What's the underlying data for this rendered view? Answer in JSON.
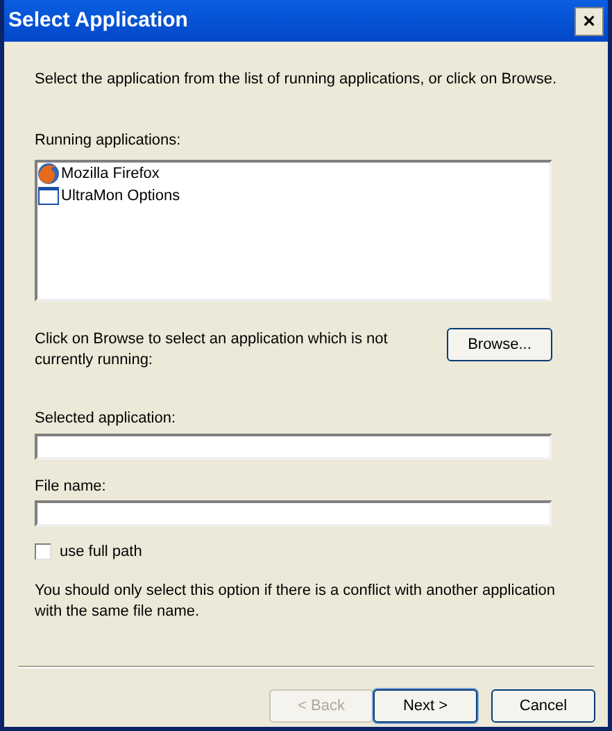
{
  "window": {
    "title": "Select Application",
    "close": "×"
  },
  "intro": "Select the application from the list of running applications, or click on Browse.",
  "running_label": "Running applications:",
  "running_applications": [
    {
      "name": "Mozilla Firefox",
      "kind": "firefox",
      "selected": false
    },
    {
      "name": "UltraMon Options",
      "kind": "window",
      "selected": false
    }
  ],
  "browse_text": "Click on Browse to select an application which is not currently running:",
  "browse_button": "Browse...",
  "selected_application": {
    "label": "Selected application:"
  },
  "file_name": {
    "label": "File name:"
  },
  "use_full_path": {
    "label": "use full path",
    "checked": false
  },
  "note": "You should only select this option if there is a conflict with another application with the same file name.",
  "buttons": [
    {
      "label": "< Back",
      "disabled": true,
      "default": false
    },
    {
      "label": "Next >",
      "disabled": false,
      "default": true
    },
    {
      "label": "Cancel",
      "disabled": false,
      "default": false
    }
  ]
}
